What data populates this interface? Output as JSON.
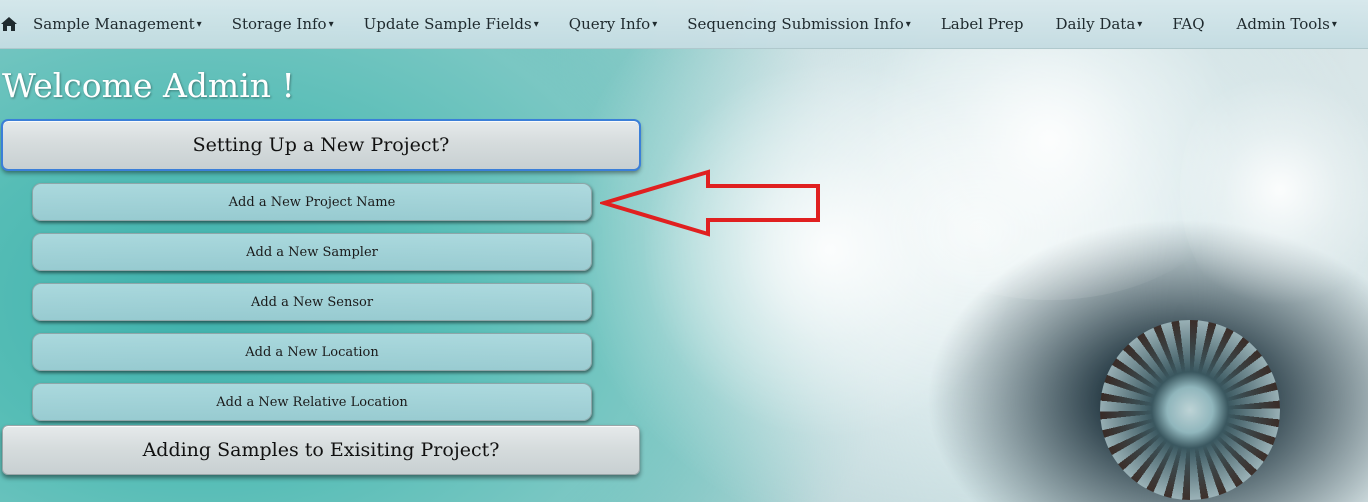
{
  "nav": {
    "home_icon": "home-icon",
    "items": [
      {
        "label": "Sample Management",
        "caret": "▾"
      },
      {
        "label": "Storage Info",
        "caret": "▾"
      },
      {
        "label": "Update Sample Fields",
        "caret": "▾"
      },
      {
        "label": "Query Info",
        "caret": "▾"
      },
      {
        "label": "Sequencing Submission Info",
        "caret": "▾"
      },
      {
        "label": "Label Prep",
        "caret": ""
      },
      {
        "label": "Daily Data",
        "caret": "▾"
      },
      {
        "label": "FAQ",
        "caret": ""
      },
      {
        "label": "Admin Tools",
        "caret": "▾"
      }
    ],
    "logout_icon": "logout-icon"
  },
  "main": {
    "welcome": "Welcome Admin !",
    "sections": [
      {
        "label": "Setting Up a New Project?",
        "active": true,
        "items": [
          "Add a New Project Name",
          "Add a New Sampler",
          "Add a New Sensor",
          "Add a New Location",
          "Add a New Relative Location"
        ]
      },
      {
        "label": "Adding Samples to Exisiting Project?",
        "active": false,
        "items": []
      }
    ]
  },
  "annotation": {
    "icon": "arrow-left-icon",
    "color": "#e02020"
  }
}
